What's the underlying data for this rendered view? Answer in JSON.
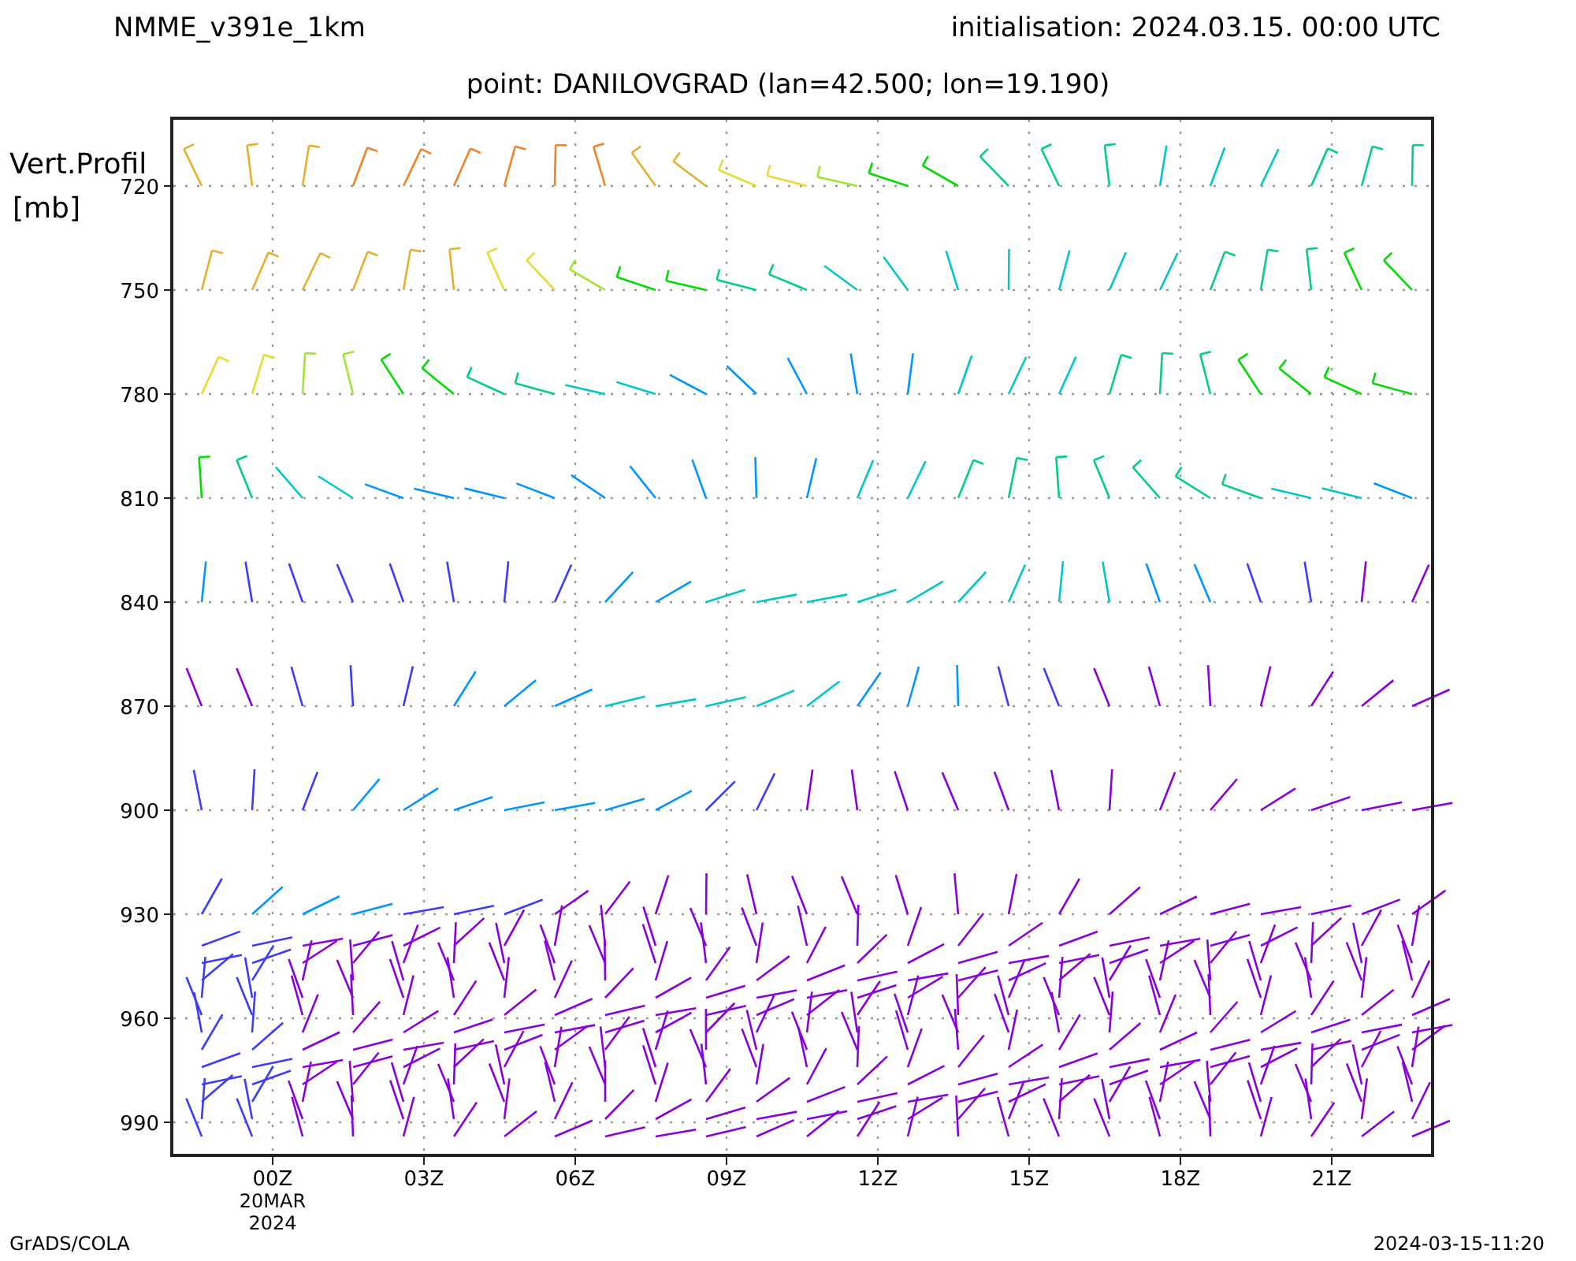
{
  "title": "NMME_v391e_1km",
  "initialisation": "initialisation:  2024.03.15.  00:00  UTC",
  "point": "point:  DANILOVGRAD  (lan=42.500;  lon=19.190)",
  "y_axis": {
    "title_lines": [
      "Vert.Profil",
      "[mb]"
    ],
    "ticks": [
      "720",
      "750",
      "780",
      "810",
      "840",
      "870",
      "900",
      "930",
      "960",
      "990"
    ]
  },
  "x_axis": {
    "ticks": [
      {
        "label": "00Z",
        "sub_lines": [
          "20MAR",
          "2024"
        ]
      },
      {
        "label": "03Z"
      },
      {
        "label": "06Z"
      },
      {
        "label": "09Z"
      },
      {
        "label": "12Z"
      },
      {
        "label": "15Z"
      },
      {
        "label": "18Z"
      },
      {
        "label": "21Z"
      }
    ]
  },
  "footer": {
    "left": "GrADS/COLA",
    "right": "2024-03-15-11:20"
  }
}
